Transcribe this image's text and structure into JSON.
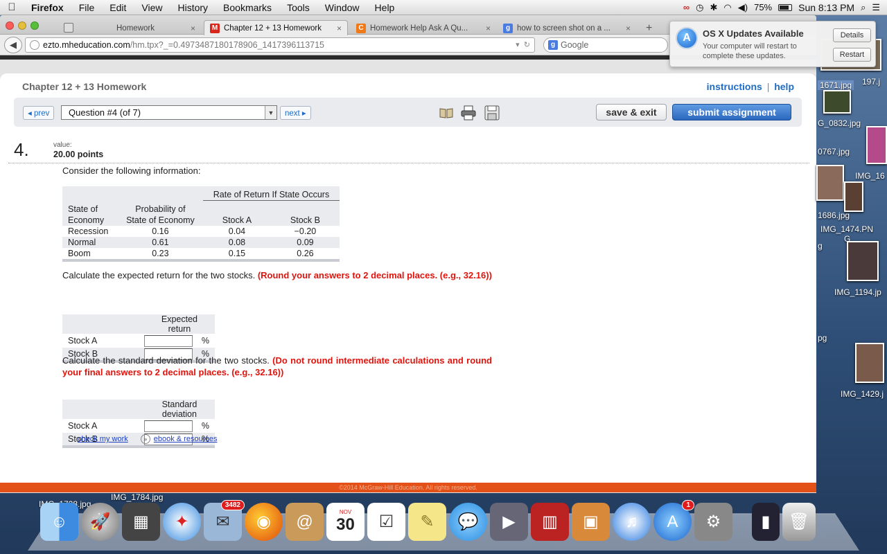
{
  "menubar": {
    "app": "Firefox",
    "items": [
      "File",
      "Edit",
      "View",
      "History",
      "Bookmarks",
      "Tools",
      "Window",
      "Help"
    ],
    "battery": "75%",
    "clock": "Sun 8:13 PM"
  },
  "tabs": [
    {
      "label": "Homework",
      "close": "×"
    },
    {
      "label": "Chapter 12 + 13 Homework",
      "close": "×",
      "favicon": "M"
    },
    {
      "label": "Homework Help Ask A Qu...",
      "close": "×",
      "favicon": "C"
    },
    {
      "label": "how to screen shot on a ...",
      "close": "×",
      "favicon": "g"
    }
  ],
  "newtab": "+",
  "urlbar": {
    "host": "ezto.mheducation.com",
    "path": "/hm.tpx?_=0.4973487180178906_1417396113715"
  },
  "search": {
    "placeholder": "Google"
  },
  "notification": {
    "title": "OS X Updates Available",
    "body": "Your computer will restart to complete these updates.",
    "details": "Details",
    "restart": "Restart"
  },
  "page": {
    "chapter_title": "Chapter 12 + 13 Homework",
    "instructions": "instructions",
    "sep": "|",
    "help": "help",
    "prev": "◂ prev",
    "next": "next ▸",
    "question_select": "Question #4 (of 7)",
    "save_exit": "save & exit",
    "submit": "submit assignment",
    "qnum": "4.",
    "value_label": "value:",
    "points": "20.00 points",
    "consider": "Consider the following information:",
    "returns_table": {
      "group_header": "Rate of Return If State Occurs",
      "h_state_1": "State of",
      "h_state_2": "Economy",
      "h_prob_1": "Probability of",
      "h_prob_2": "State of Economy",
      "h_a": "Stock A",
      "h_b": "Stock B",
      "rows": [
        {
          "state": "Recession",
          "prob": "0.16",
          "a": "0.04",
          "b": "−0.20"
        },
        {
          "state": "Normal",
          "prob": "0.61",
          "a": "0.08",
          "b": "0.09"
        },
        {
          "state": "Boom",
          "prob": "0.23",
          "a": "0.15",
          "b": "0.26"
        }
      ]
    },
    "q1_text": "Calculate the expected return for the two stocks.",
    "q1_red": "(Round your answers to 2 decimal places. (e.g., 32.16))",
    "expected": {
      "header": "Expected return",
      "row_a": "Stock A",
      "row_b": "Stock B",
      "unit": "%"
    },
    "q2_text": "Calculate the standard deviation for the two stocks.",
    "q2_red": "(Do not round intermediate calculations and round your final answers to 2 decimal places. (e.g., 32.16))",
    "stdev": {
      "header": "Standard deviation",
      "row_a": "Stock A",
      "row_b": "Stock B",
      "unit": "%"
    },
    "check_work": "check my work",
    "ebook": "ebook & resources",
    "footer": "©2014 McGraw-Hill Education. All rights reserved."
  },
  "desktop_files": [
    "197.j",
    "1671.jpg",
    "G_0832.jpg",
    "0767.jpg",
    "IMG_16",
    "1686.jpg",
    "IMG_1474.PN",
    "G",
    "g",
    "IMG_1194.jp",
    "pg",
    "IMG_1429.j",
    "IMG_1728.jpg",
    "IMG_1784.jpg"
  ],
  "dock": {
    "mail_badge": "3482",
    "appstore_badge": "1",
    "calendar_month": "NOV",
    "calendar_day": "30"
  }
}
